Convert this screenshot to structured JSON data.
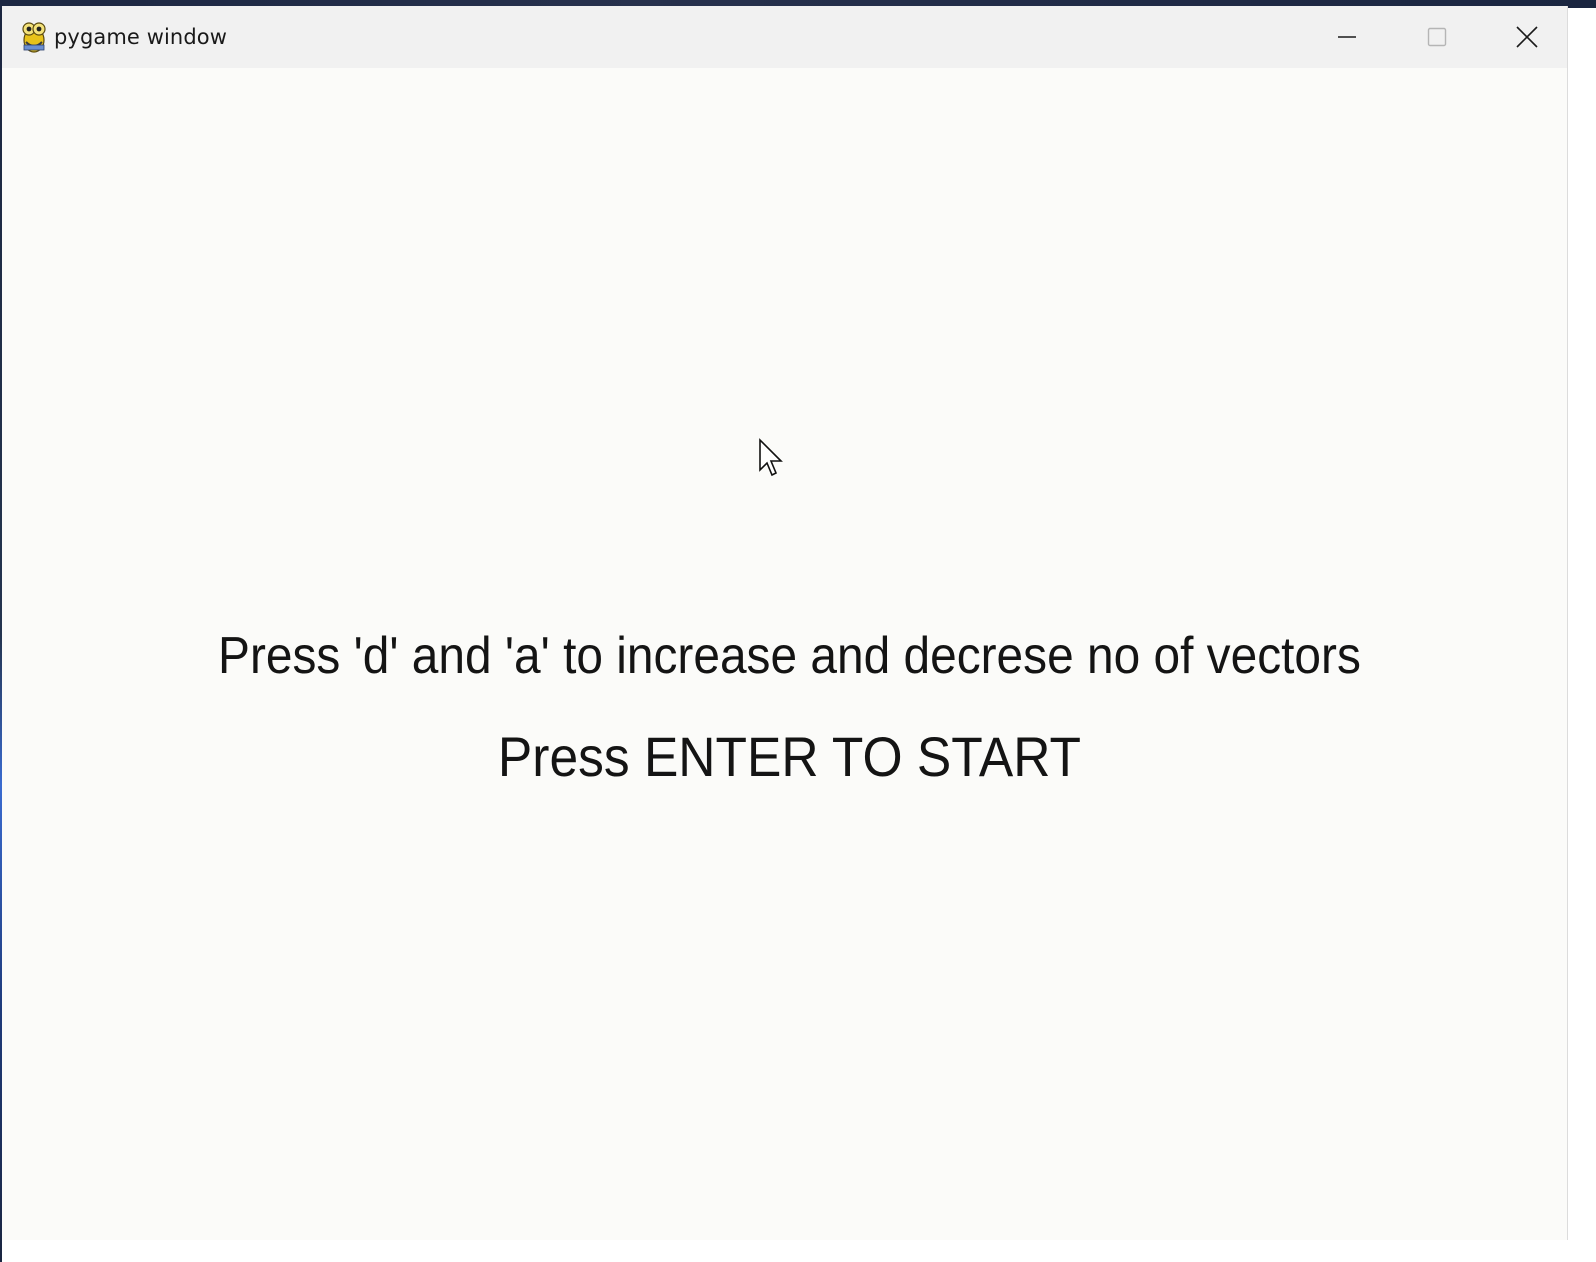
{
  "window": {
    "title": "pygame window",
    "app_icon": "pygame-snake-icon"
  },
  "titlebar_controls": {
    "minimize_icon": "minimize-icon",
    "maximize_icon": "maximize-icon",
    "close_icon": "close-icon"
  },
  "game_screen": {
    "instruction_line": "Press 'd' and 'a' to increase and decrese no of vectors",
    "start_line": "Press ENTER TO START"
  },
  "cursor": {
    "icon": "arrow-cursor-icon"
  },
  "colors": {
    "background": "#fbfbf9",
    "titlebar": "#f1f1f1",
    "text": "#141414"
  }
}
